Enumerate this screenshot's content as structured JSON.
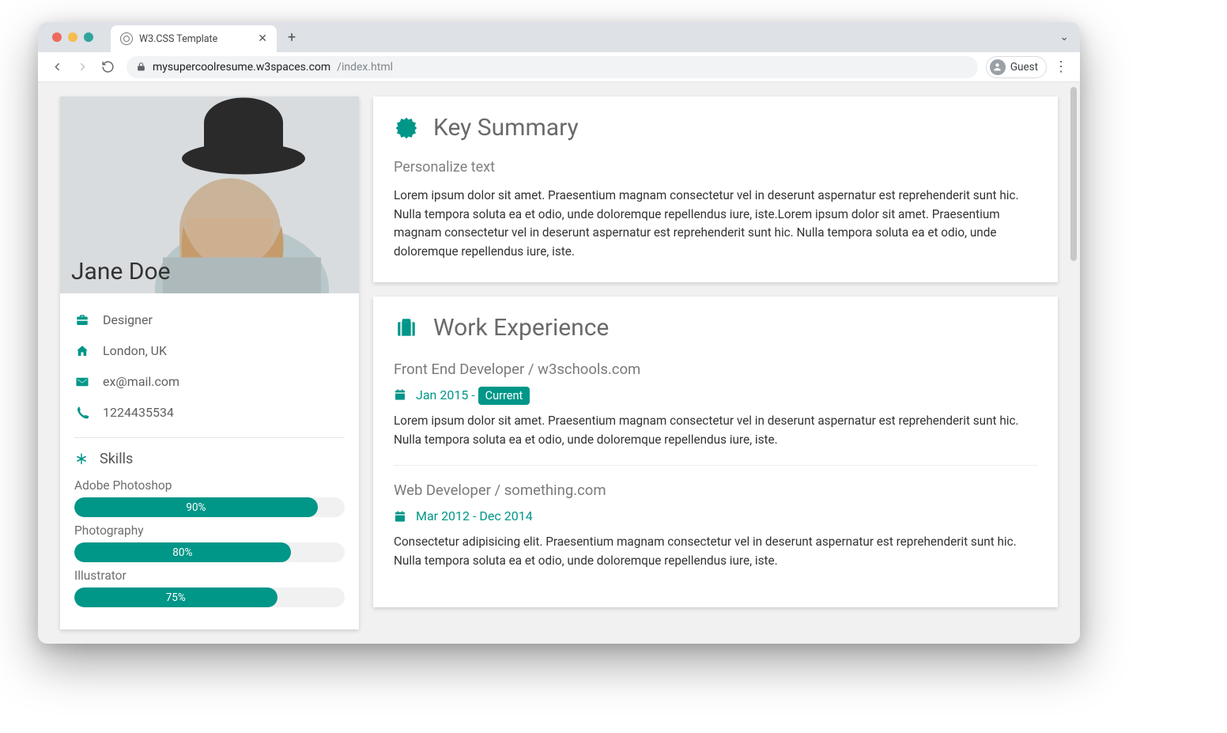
{
  "browser": {
    "tab_title": "W3.CSS Template",
    "url_host": "mysupercoolresume.w3spaces.com",
    "url_path": "/index.html",
    "guest_label": "Guest"
  },
  "profile": {
    "name": "Jane Doe",
    "role": "Designer",
    "location": "London, UK",
    "email": "ex@mail.com",
    "phone": "1224435534"
  },
  "skills": {
    "heading": "Skills",
    "items": [
      {
        "label": "Adobe Photoshop",
        "pct": 90,
        "pct_label": "90%"
      },
      {
        "label": "Photography",
        "pct": 80,
        "pct_label": "80%"
      },
      {
        "label": "Illustrator",
        "pct": 75,
        "pct_label": "75%"
      }
    ]
  },
  "summary": {
    "heading": "Key Summary",
    "subheading": "Personalize text",
    "body": "Lorem ipsum dolor sit amet. Praesentium magnam consectetur vel in deserunt aspernatur est reprehenderit sunt hic. Nulla tempora soluta ea et odio, unde doloremque repellendus iure, iste.Lorem ipsum dolor sit amet. Praesentium magnam consectetur vel in deserunt aspernatur est reprehenderit sunt hic. Nulla tempora soluta ea et odio, unde doloremque repellendus iure, iste."
  },
  "experience": {
    "heading": "Work Experience",
    "jobs": [
      {
        "title": "Front End Developer / w3schools.com",
        "date_prefix": "Jan 2015 - ",
        "badge": "Current",
        "desc": "Lorem ipsum dolor sit amet. Praesentium magnam consectetur vel in deserunt aspernatur est reprehenderit sunt hic. Nulla tempora soluta ea et odio, unde doloremque repellendus iure, iste."
      },
      {
        "title": "Web Developer / something.com",
        "date_full": "Mar 2012 - Dec 2014",
        "desc": "Consectetur adipisicing elit. Praesentium magnam consectetur vel in deserunt aspernatur est reprehenderit sunt hic. Nulla tempora soluta ea et odio, unde doloremque repellendus iure, iste."
      }
    ]
  },
  "colors": {
    "teal": "#009688"
  }
}
